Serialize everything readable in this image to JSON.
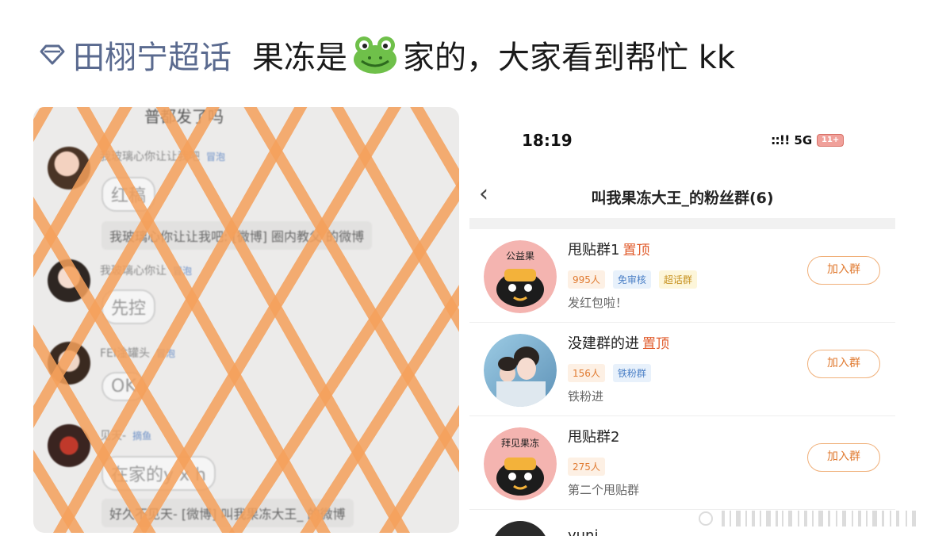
{
  "post": {
    "topic": "田栩宁超话",
    "text_before": "果冻是",
    "text_after": "家的，大家看到帮忙 kk",
    "emoji": "frog-emoji"
  },
  "left_screenshot": {
    "top_message": "普都发了吗",
    "messages": [
      {
        "nick": "我玻璃心你让让我吧",
        "tag": "冒泡",
        "bubble": "红稿"
      },
      {
        "nick": "我玻璃心你让",
        "tag": "冒泡",
        "bubble": "先控"
      },
      {
        "nick": "FEI淦罐头",
        "tag": "冒泡",
        "bubble": "OK"
      },
      {
        "nick": "见天-",
        "tag": "摘鱼",
        "bubble": "在家的y x h"
      }
    ],
    "quotes": [
      "我玻璃心你让让我吧: [微博] 圈内教父 的微博",
      "好久不见天- [微博] 叫我果冻大王_ 的微博"
    ],
    "stripe_color": "#f5a05a"
  },
  "phone": {
    "time": "18:19",
    "signal": "::!!",
    "network": "5G",
    "battery": "11+",
    "title": "叫我果冻大王_的粉丝群(6)",
    "groups": [
      {
        "name": "甩贴群1",
        "pin": "置顶",
        "tags": [
          "995人",
          "免审核",
          "超话群"
        ],
        "desc": "发红包啦！",
        "join": "加入群",
        "avatar_text": "公益果"
      },
      {
        "name": "没建群的进",
        "pin": "置顶",
        "tags": [
          "156人",
          "铁粉群"
        ],
        "desc": "铁粉进",
        "join": "加入群",
        "avatar_text": ""
      },
      {
        "name": "甩贴群2",
        "pin": "",
        "tags": [
          "275人"
        ],
        "desc": "第二个甩贴群",
        "join": "加入群",
        "avatar_text": "拜见果冻"
      }
    ],
    "partial_group_name": "yuni"
  },
  "colors": {
    "topic": "#5a6a8f",
    "accent_orange": "#e07a30",
    "pin_red": "#e05a2a"
  }
}
